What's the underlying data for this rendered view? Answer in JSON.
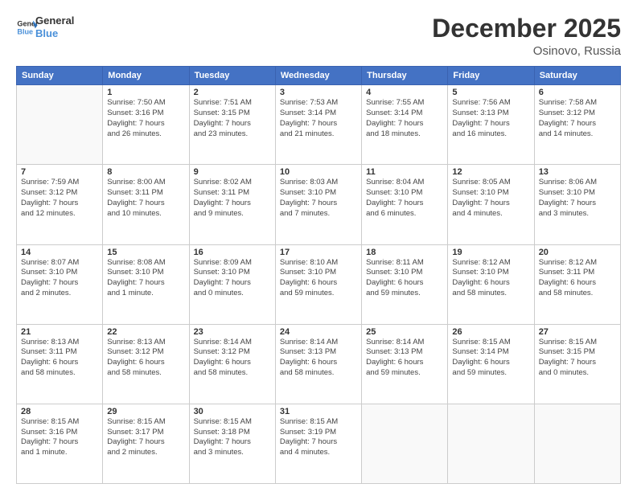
{
  "logo": {
    "line1": "General",
    "line2": "Blue"
  },
  "title": "December 2025",
  "subtitle": "Osinovo, Russia",
  "days_of_week": [
    "Sunday",
    "Monday",
    "Tuesday",
    "Wednesday",
    "Thursday",
    "Friday",
    "Saturday"
  ],
  "weeks": [
    [
      {
        "num": "",
        "info": ""
      },
      {
        "num": "1",
        "info": "Sunrise: 7:50 AM\nSunset: 3:16 PM\nDaylight: 7 hours\nand 26 minutes."
      },
      {
        "num": "2",
        "info": "Sunrise: 7:51 AM\nSunset: 3:15 PM\nDaylight: 7 hours\nand 23 minutes."
      },
      {
        "num": "3",
        "info": "Sunrise: 7:53 AM\nSunset: 3:14 PM\nDaylight: 7 hours\nand 21 minutes."
      },
      {
        "num": "4",
        "info": "Sunrise: 7:55 AM\nSunset: 3:14 PM\nDaylight: 7 hours\nand 18 minutes."
      },
      {
        "num": "5",
        "info": "Sunrise: 7:56 AM\nSunset: 3:13 PM\nDaylight: 7 hours\nand 16 minutes."
      },
      {
        "num": "6",
        "info": "Sunrise: 7:58 AM\nSunset: 3:12 PM\nDaylight: 7 hours\nand 14 minutes."
      }
    ],
    [
      {
        "num": "7",
        "info": "Sunrise: 7:59 AM\nSunset: 3:12 PM\nDaylight: 7 hours\nand 12 minutes."
      },
      {
        "num": "8",
        "info": "Sunrise: 8:00 AM\nSunset: 3:11 PM\nDaylight: 7 hours\nand 10 minutes."
      },
      {
        "num": "9",
        "info": "Sunrise: 8:02 AM\nSunset: 3:11 PM\nDaylight: 7 hours\nand 9 minutes."
      },
      {
        "num": "10",
        "info": "Sunrise: 8:03 AM\nSunset: 3:10 PM\nDaylight: 7 hours\nand 7 minutes."
      },
      {
        "num": "11",
        "info": "Sunrise: 8:04 AM\nSunset: 3:10 PM\nDaylight: 7 hours\nand 6 minutes."
      },
      {
        "num": "12",
        "info": "Sunrise: 8:05 AM\nSunset: 3:10 PM\nDaylight: 7 hours\nand 4 minutes."
      },
      {
        "num": "13",
        "info": "Sunrise: 8:06 AM\nSunset: 3:10 PM\nDaylight: 7 hours\nand 3 minutes."
      }
    ],
    [
      {
        "num": "14",
        "info": "Sunrise: 8:07 AM\nSunset: 3:10 PM\nDaylight: 7 hours\nand 2 minutes."
      },
      {
        "num": "15",
        "info": "Sunrise: 8:08 AM\nSunset: 3:10 PM\nDaylight: 7 hours\nand 1 minute."
      },
      {
        "num": "16",
        "info": "Sunrise: 8:09 AM\nSunset: 3:10 PM\nDaylight: 7 hours\nand 0 minutes."
      },
      {
        "num": "17",
        "info": "Sunrise: 8:10 AM\nSunset: 3:10 PM\nDaylight: 6 hours\nand 59 minutes."
      },
      {
        "num": "18",
        "info": "Sunrise: 8:11 AM\nSunset: 3:10 PM\nDaylight: 6 hours\nand 59 minutes."
      },
      {
        "num": "19",
        "info": "Sunrise: 8:12 AM\nSunset: 3:10 PM\nDaylight: 6 hours\nand 58 minutes."
      },
      {
        "num": "20",
        "info": "Sunrise: 8:12 AM\nSunset: 3:11 PM\nDaylight: 6 hours\nand 58 minutes."
      }
    ],
    [
      {
        "num": "21",
        "info": "Sunrise: 8:13 AM\nSunset: 3:11 PM\nDaylight: 6 hours\nand 58 minutes."
      },
      {
        "num": "22",
        "info": "Sunrise: 8:13 AM\nSunset: 3:12 PM\nDaylight: 6 hours\nand 58 minutes."
      },
      {
        "num": "23",
        "info": "Sunrise: 8:14 AM\nSunset: 3:12 PM\nDaylight: 6 hours\nand 58 minutes."
      },
      {
        "num": "24",
        "info": "Sunrise: 8:14 AM\nSunset: 3:13 PM\nDaylight: 6 hours\nand 58 minutes."
      },
      {
        "num": "25",
        "info": "Sunrise: 8:14 AM\nSunset: 3:13 PM\nDaylight: 6 hours\nand 59 minutes."
      },
      {
        "num": "26",
        "info": "Sunrise: 8:15 AM\nSunset: 3:14 PM\nDaylight: 6 hours\nand 59 minutes."
      },
      {
        "num": "27",
        "info": "Sunrise: 8:15 AM\nSunset: 3:15 PM\nDaylight: 7 hours\nand 0 minutes."
      }
    ],
    [
      {
        "num": "28",
        "info": "Sunrise: 8:15 AM\nSunset: 3:16 PM\nDaylight: 7 hours\nand 1 minute."
      },
      {
        "num": "29",
        "info": "Sunrise: 8:15 AM\nSunset: 3:17 PM\nDaylight: 7 hours\nand 2 minutes."
      },
      {
        "num": "30",
        "info": "Sunrise: 8:15 AM\nSunset: 3:18 PM\nDaylight: 7 hours\nand 3 minutes."
      },
      {
        "num": "31",
        "info": "Sunrise: 8:15 AM\nSunset: 3:19 PM\nDaylight: 7 hours\nand 4 minutes."
      },
      {
        "num": "",
        "info": ""
      },
      {
        "num": "",
        "info": ""
      },
      {
        "num": "",
        "info": ""
      }
    ]
  ]
}
